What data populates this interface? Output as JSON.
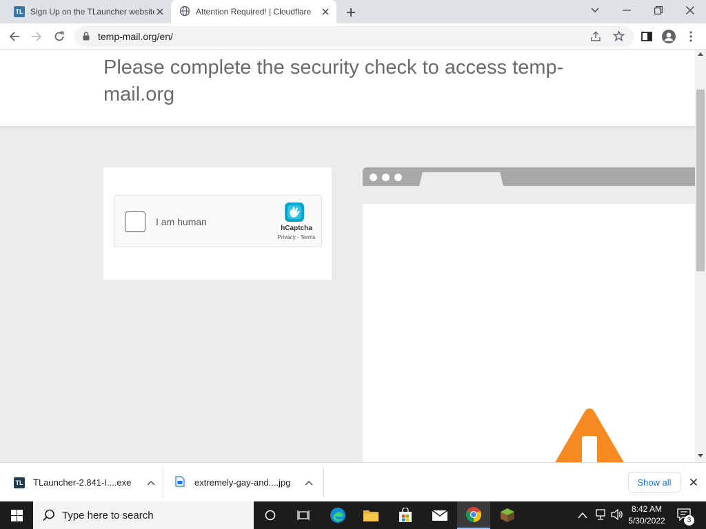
{
  "browser": {
    "tabs": [
      {
        "label": "Sign Up on the TLauncher website",
        "favicon": "tlauncher-favicon",
        "active": false
      },
      {
        "label": "Attention Required! | Cloudflare",
        "favicon": "globe-icon",
        "active": true
      }
    ],
    "address": "temp-mail.org/en/",
    "colors": {
      "tabstrip": "#dee1e6",
      "omnibox": "#f1f3f4"
    }
  },
  "page": {
    "subheading": "Please complete the security check to access temp-mail.org",
    "captcha": {
      "checkbox_label": "I am human",
      "brand": "hCaptcha",
      "links": "Privacy - Terms"
    },
    "warning_color": "#f6891f"
  },
  "downloads": {
    "items": [
      {
        "filename": "TLauncher-2.841-I....exe",
        "icon": "tlauncher-icon"
      },
      {
        "filename": "extremely-gay-and....jpg",
        "icon": "image-file-icon"
      }
    ],
    "show_all_label": "Show all"
  },
  "taskbar": {
    "search_placeholder": "Type here to search",
    "time": "8:42 AM",
    "date": "5/30/2022",
    "notification_count": "3"
  }
}
